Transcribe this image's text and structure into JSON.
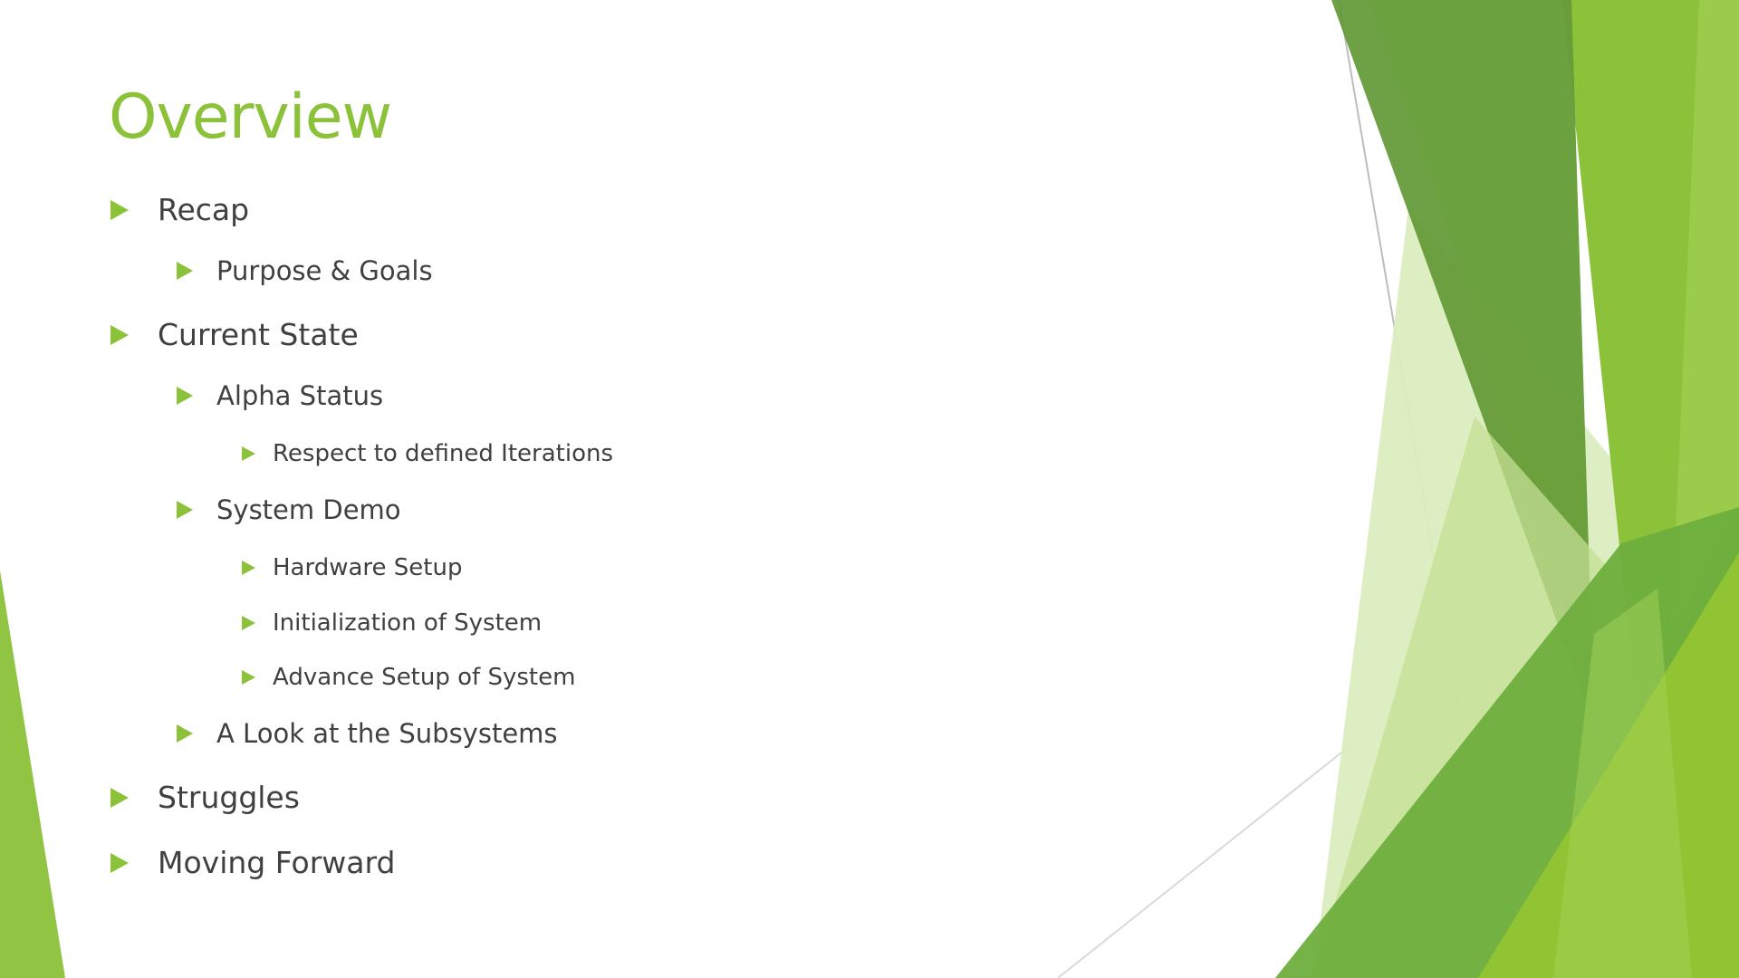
{
  "slide": {
    "title": "Overview",
    "bullets": [
      {
        "label": "Recap",
        "level": 1
      },
      {
        "label": "Purpose & Goals",
        "level": 2
      },
      {
        "label": "Current State",
        "level": 1
      },
      {
        "label": "Alpha Status",
        "level": 2
      },
      {
        "label": "Respect to defined Iterations",
        "level": 3
      },
      {
        "label": "System Demo",
        "level": 2
      },
      {
        "label": "Hardware Setup",
        "level": 3
      },
      {
        "label": "Initialization of System",
        "level": 3
      },
      {
        "label": "Advance Setup of System",
        "level": 3
      },
      {
        "label": "A Look at the Subsystems",
        "level": 2
      },
      {
        "label": "Struggles",
        "level": 1
      },
      {
        "label": "Moving Forward",
        "level": 1
      }
    ]
  },
  "theme": {
    "accent": "#8cc13a",
    "text": "#404040",
    "background": "#ffffff",
    "bullet_icon": "triangle-right-icon"
  }
}
